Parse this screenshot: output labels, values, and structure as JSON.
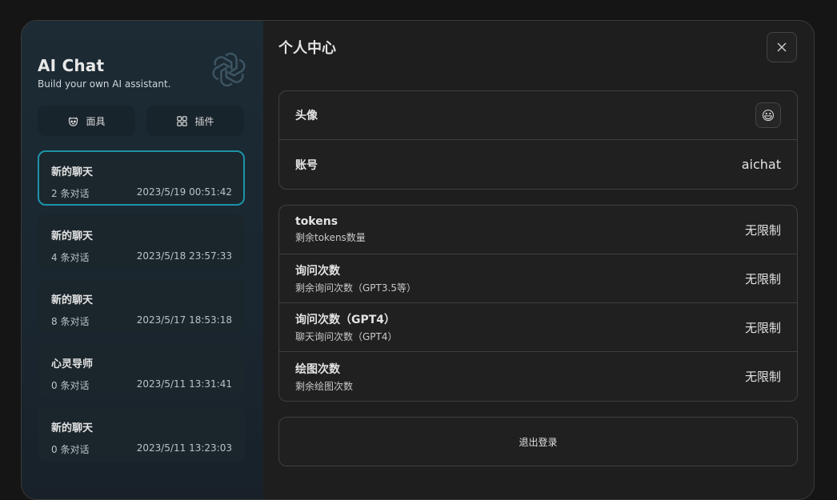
{
  "sidebar": {
    "title": "AI Chat",
    "subtitle": "Build your own AI assistant.",
    "tools": [
      {
        "label": "面具",
        "icon": "mask-icon"
      },
      {
        "label": "插件",
        "icon": "plugin-grid-icon"
      }
    ],
    "chats": [
      {
        "title": "新的聊天",
        "count": "2 条对话",
        "time": "2023/5/19 00:51:42",
        "active": true
      },
      {
        "title": "新的聊天",
        "count": "4 条对话",
        "time": "2023/5/18 23:57:33"
      },
      {
        "title": "新的聊天",
        "count": "8 条对话",
        "time": "2023/5/17 18:53:18"
      },
      {
        "title": "心灵导师",
        "count": "0 条对话",
        "time": "2023/5/11 13:31:41"
      },
      {
        "title": "新的聊天",
        "count": "0 条对话",
        "time": "2023/5/11 13:23:03"
      }
    ]
  },
  "main": {
    "title": "个人中心",
    "profile": {
      "avatar_label": "头像",
      "avatar_emoji": "😃",
      "account_label": "账号",
      "account_value": "aichat"
    },
    "quota": [
      {
        "label": "tokens",
        "sub": "剩余tokens数量",
        "value": "无限制"
      },
      {
        "label": "询问次数",
        "sub": "剩余询问次数（GPT3.5等）",
        "value": "无限制"
      },
      {
        "label": "询问次数（GPT4）",
        "sub": "聊天询问次数（GPT4）",
        "value": "无限制"
      },
      {
        "label": "绘图次数",
        "sub": "剩余绘图次数",
        "value": "无限制"
      }
    ],
    "logout_label": "退出登录"
  }
}
